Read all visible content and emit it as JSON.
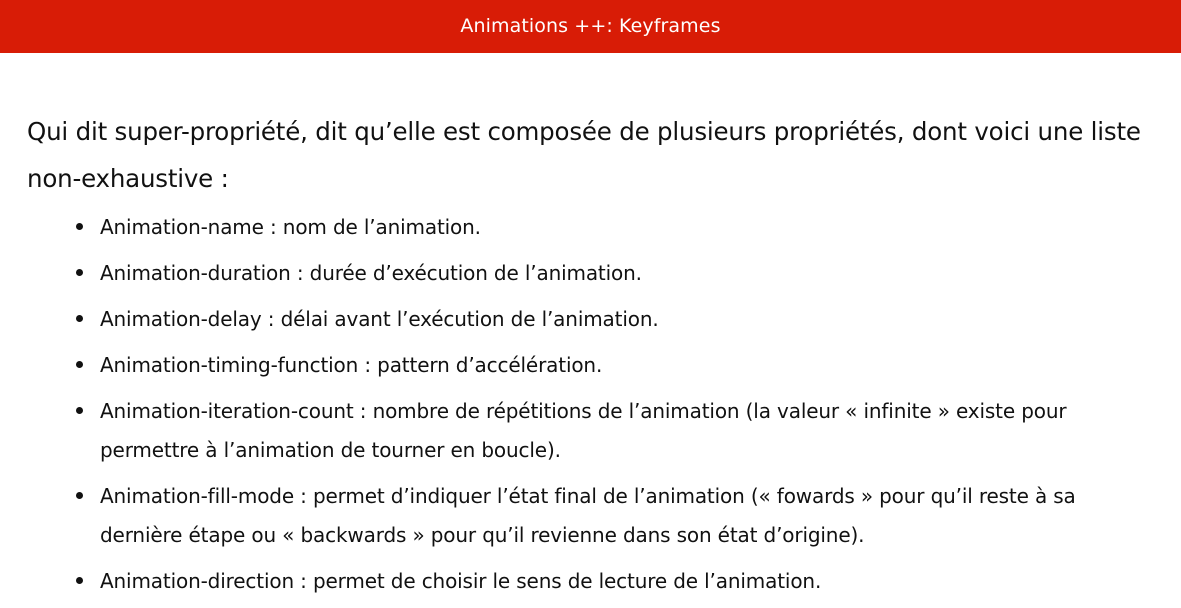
{
  "header": {
    "title": "Animations ++: Keyframes",
    "background_color": "#d81c06"
  },
  "intro": {
    "text": "Qui dit super-propriété, dit qu’elle est composée de plusieurs propriétés, dont voici une liste non-exhaustive :"
  },
  "bullets": [
    {
      "text": "Animation-name : nom de l’animation."
    },
    {
      "text": "Animation-duration : durée d’exécution de l’animation."
    },
    {
      "text": "Animation-delay : délai avant l’exécution de l’animation."
    },
    {
      "text": "Animation-timing-function : pattern d’accélération."
    },
    {
      "text": "Animation-iteration-count : nombre de répétitions de l’animation (la valeur « infinite » existe pour permettre à l’animation de tourner en boucle)."
    },
    {
      "text": "Animation-fill-mode : permet d’indiquer l’état final de l’animation (« fowards » pour qu’il reste à sa dernière étape ou « backwards » pour qu’il revienne dans son état d’origine)."
    },
    {
      "text": "Animation-direction : permet de choisir le sens de lecture de l’animation."
    }
  ]
}
